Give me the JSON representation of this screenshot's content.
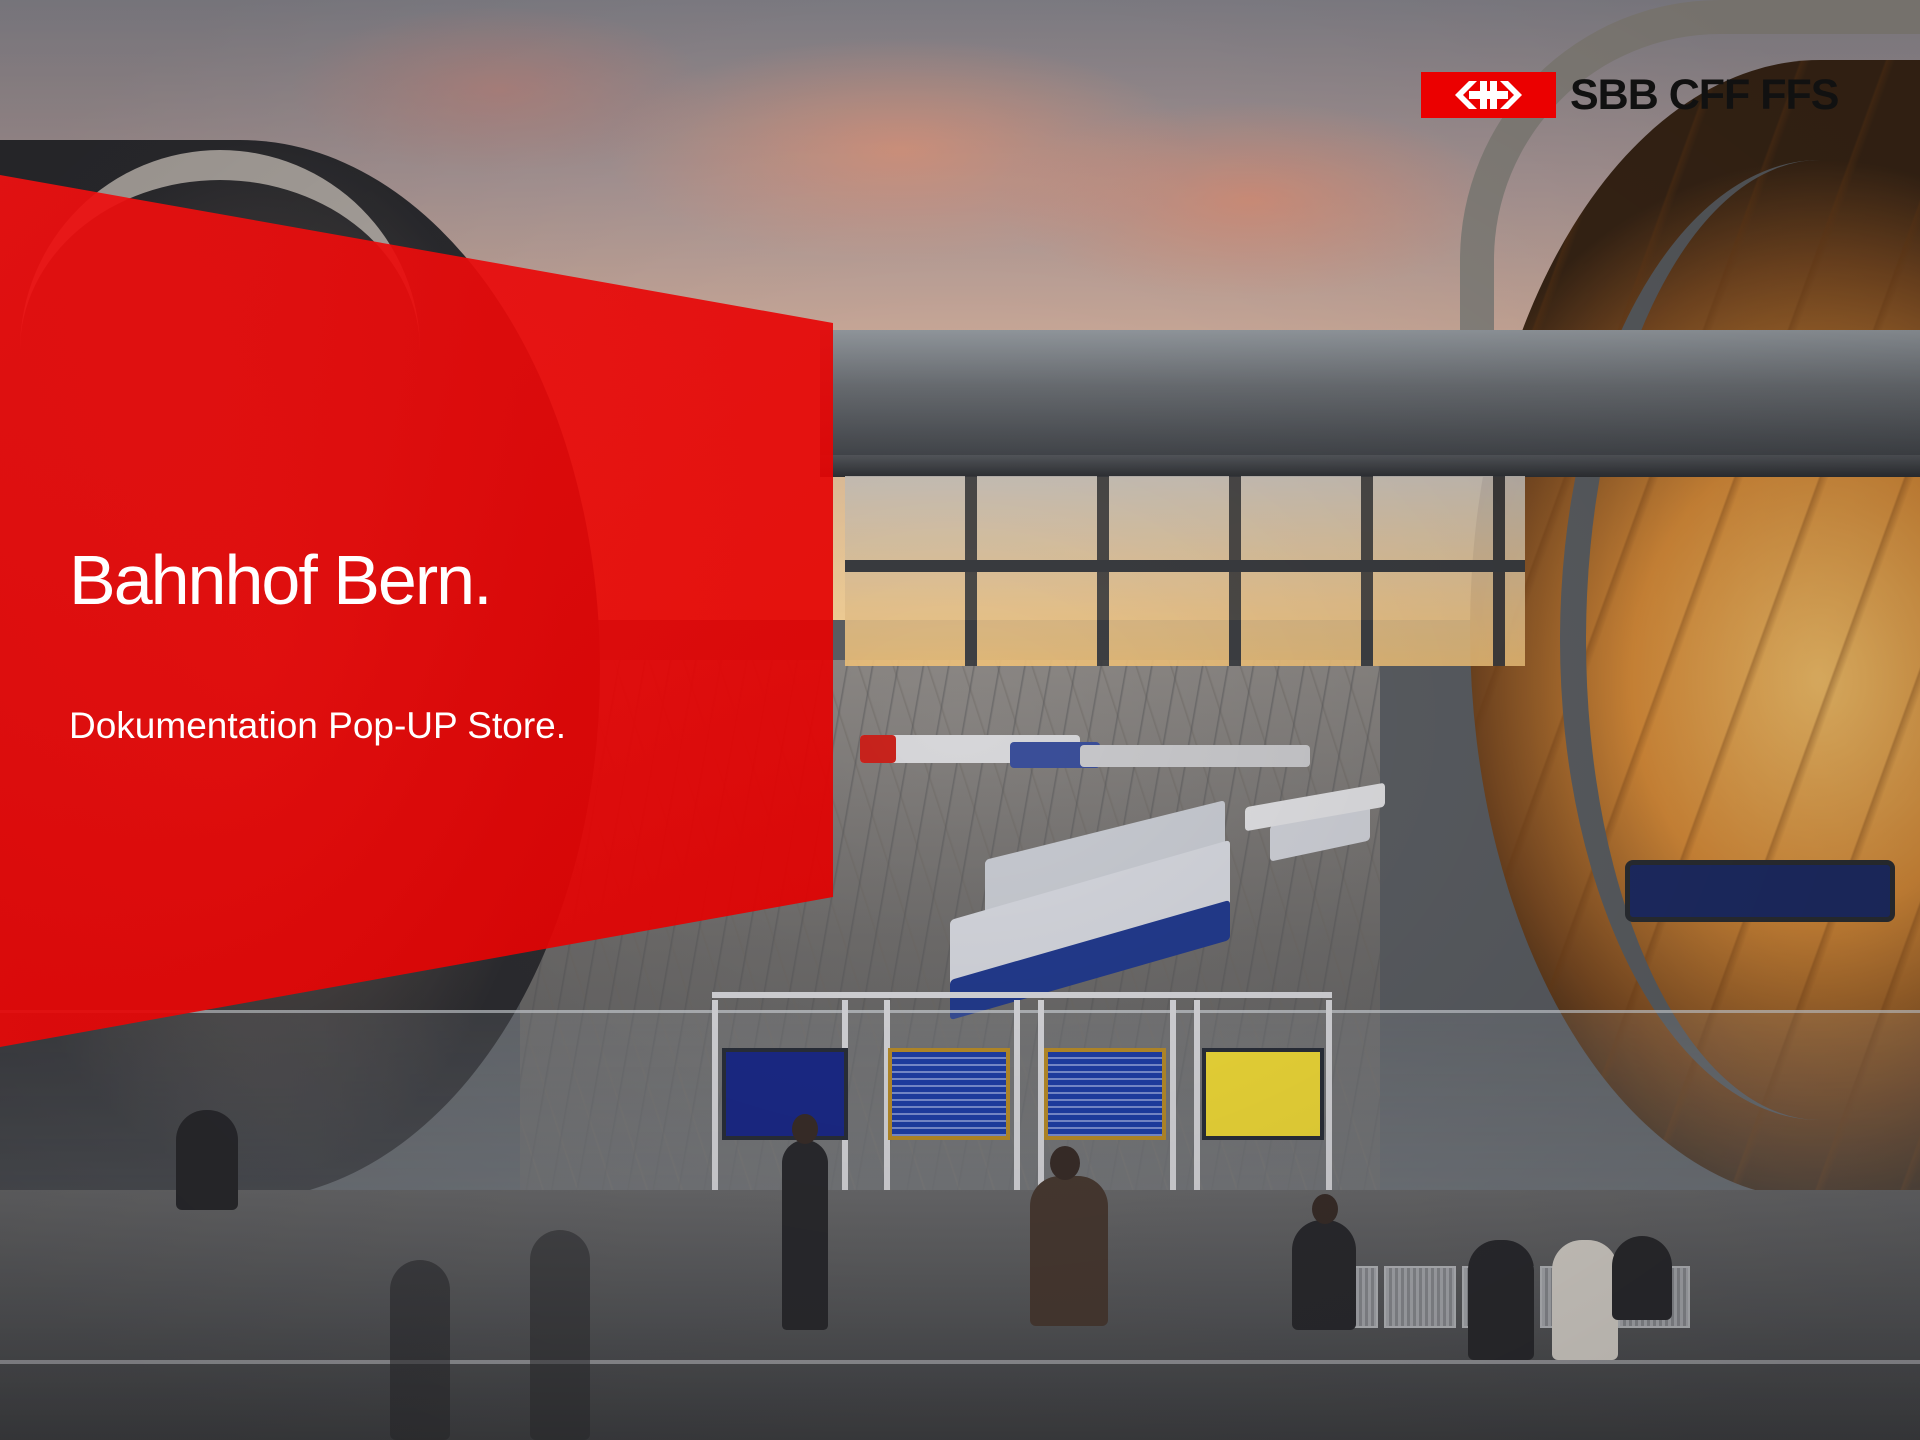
{
  "slide": {
    "title": "Bahnhof Bern.",
    "subtitle": "Dokumentation Pop-UP Store."
  },
  "logo": {
    "wordmark": "SBB CFF FFS",
    "icon": "swiss-railway-double-arrow-cross-icon",
    "brand_color": "#eb0000"
  },
  "background": {
    "image": "station-hall-photo"
  },
  "colors": {
    "accent": "#eb0000",
    "title_text": "#ffffff",
    "logo_text": "#111111"
  }
}
